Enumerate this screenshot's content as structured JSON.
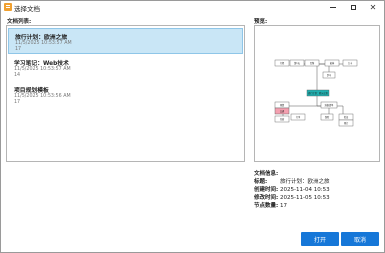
{
  "window": {
    "title": "选择文档"
  },
  "labels": {
    "doc_list": "文档列表:",
    "preview": "预览:",
    "info": "文档信息:"
  },
  "documents": [
    {
      "name": "旅行计划：欧洲之旅",
      "time": "11/5/2025 10:53:57 AM",
      "count": "17"
    },
    {
      "name": "学习笔记：Web技术",
      "time": "11/5/2025 10:53:57 AM",
      "count": "14"
    },
    {
      "name": "项目规划模板",
      "time": "11/5/2025 10:53:56 AM",
      "count": "17"
    }
  ],
  "info": {
    "title_key": "标题:",
    "title_val": "旅行计划：欧洲之旅",
    "created_key": "创建时间:",
    "created_val": "2025-11-04 10:53",
    "modified_key": "修改时间:",
    "modified_val": "2025-11-05 10:53",
    "nodes_key": "节点数量:",
    "nodes_val": "17"
  },
  "buttons": {
    "open": "打开",
    "cancel": "取消"
  },
  "preview_nodes": [
    {
      "label": "行程",
      "color": "#ffffff"
    },
    {
      "label": "第1天",
      "color": "#ffffff"
    },
    {
      "label": "巴黎",
      "color": "#ffffff"
    },
    {
      "label": "柏林",
      "color": "#ffffff"
    },
    {
      "label": "大卡",
      "color": "#ffffff"
    },
    {
      "label": "罗马",
      "color": "#ffffff"
    },
    {
      "label": "旅行计划：欧洲之旅",
      "color": "#20b0b0"
    },
    {
      "label": "预算",
      "color": "#ffffff"
    },
    {
      "label": "交通",
      "color": "#f4a0b0"
    },
    {
      "label": "准备清单",
      "color": "#ffffff"
    },
    {
      "label": "住宿",
      "color": "#ffffff"
    },
    {
      "label": "行李",
      "color": "#ffffff"
    },
    {
      "label": "保险",
      "color": "#ffffff"
    },
    {
      "label": "签证",
      "color": "#ffffff"
    },
    {
      "label": "预订",
      "color": "#ffffff"
    }
  ],
  "colors": {
    "accent": "#1677d8",
    "selected": "#c9e6f6",
    "central_node": "#20b0b0",
    "pink_node": "#f4a0b0"
  }
}
